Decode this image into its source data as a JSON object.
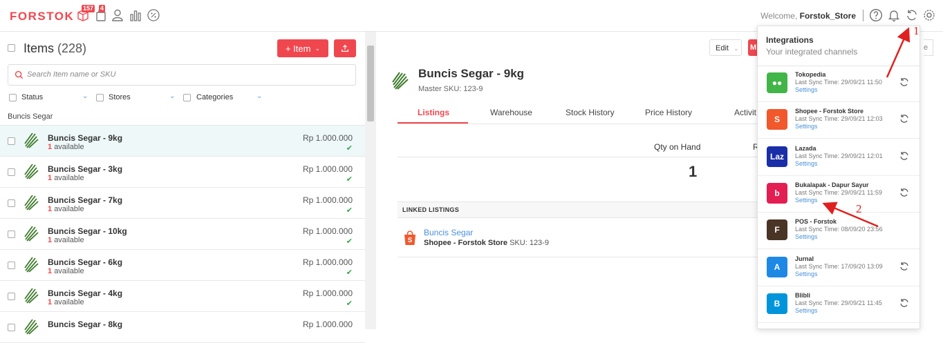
{
  "brand": {
    "logo": "FORSTOK",
    "accent": "#f0474f"
  },
  "nav": {
    "orders_badge": "157",
    "items_badge": "4"
  },
  "header": {
    "welcome_prefix": "Welcome,",
    "user": "Forstok_Store"
  },
  "items_panel": {
    "title": "Items",
    "count": "(228)",
    "add_button": "+ Item",
    "search_placeholder": "Search Item name or SKU",
    "filters": [
      "Status",
      "Stores",
      "Categories"
    ],
    "group_label": "Buncis Segar",
    "rows": [
      {
        "name": "Buncis Segar - 9kg",
        "qty": "1",
        "avail": "available",
        "price": "Rp 1.000.000"
      },
      {
        "name": "Buncis Segar - 3kg",
        "qty": "1",
        "avail": "available",
        "price": "Rp 1.000.000"
      },
      {
        "name": "Buncis Segar - 7kg",
        "qty": "1",
        "avail": "available",
        "price": "Rp 1.000.000"
      },
      {
        "name": "Buncis Segar - 10kg",
        "qty": "1",
        "avail": "available",
        "price": "Rp 1.000.000"
      },
      {
        "name": "Buncis Segar - 6kg",
        "qty": "1",
        "avail": "available",
        "price": "Rp 1.000.000"
      },
      {
        "name": "Buncis Segar - 4kg",
        "qty": "1",
        "avail": "available",
        "price": "Rp 1.000.000"
      },
      {
        "name": "Buncis Segar - 8kg",
        "qty": "",
        "avail": "",
        "price": "Rp 1.000.000"
      }
    ]
  },
  "detail": {
    "title": "Buncis Segar - 9kg",
    "master_sku": "Master SKU: 123-9",
    "edit_button": "Edit",
    "red_button_stub": "M",
    "right_stub": "e",
    "tabs": [
      "Listings",
      "Warehouse",
      "Stock History",
      "Price History",
      "Activit"
    ],
    "qty_label": "Qty on Hand",
    "qty_value": "1",
    "cut_label": "R",
    "linked_header": "LINKED LISTINGS",
    "linked_name": "Buncis Segar",
    "linked_store": "Shopee - Forstok Store",
    "linked_sku": "SKU: 123-9"
  },
  "integrations": {
    "title": "Integrations",
    "subtitle": "Your integrated channels",
    "settings_label": "Settings",
    "channels": [
      {
        "name": "Tokopedia",
        "sync": "Last Sync Time: 29/09/21 11:50",
        "logo_color": "#42b549",
        "glyph": "●●"
      },
      {
        "name": "Shopee - Forstok Store",
        "sync": "Last Sync Time: 29/09/21 12:03",
        "logo_color": "#f1582c",
        "glyph": "S"
      },
      {
        "name": "Lazada",
        "sync": "Last Sync Time: 29/09/21 12:01",
        "logo_color": "#1a2ea8",
        "glyph": "Laz"
      },
      {
        "name": "Bukalapak - Dapur Sayur",
        "sync": "Last Sync Time: 29/09/21 11:59",
        "logo_color": "#e31e52",
        "glyph": "b"
      },
      {
        "name": "POS - Forstok",
        "sync": "Last Sync Time: 08/09/20 23:56",
        "logo_color": "#4a3426",
        "glyph": "F"
      },
      {
        "name": "Jurnal",
        "sync": "Last Sync Time: 17/09/20 13:09",
        "logo_color": "#1e88e5",
        "glyph": "A"
      },
      {
        "name": "Blibli",
        "sync": "Last Sync Time: 29/09/21 11:45",
        "logo_color": "#0095da",
        "glyph": "B"
      }
    ]
  },
  "annotations": {
    "arrow1": "1",
    "arrow2": "2"
  }
}
